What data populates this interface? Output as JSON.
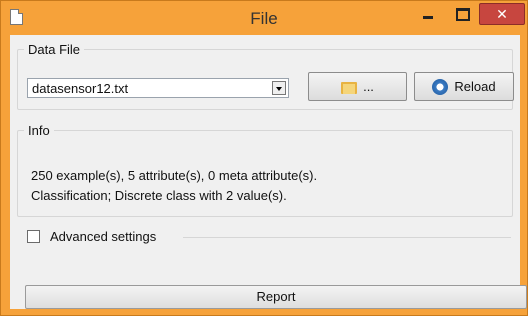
{
  "window": {
    "title": "File",
    "close_label": "✕"
  },
  "data_file": {
    "legend": "Data File",
    "selected_file": "datasensor12.txt",
    "browse_label": "...",
    "reload_label": "Reload"
  },
  "info": {
    "legend": "Info",
    "line1": "250 example(s), 5 attribute(s), 0 meta attribute(s).",
    "line2": "Classification; Discrete class with 2 value(s)."
  },
  "advanced": {
    "label": "Advanced settings",
    "checked": false
  },
  "report": {
    "label": "Report"
  },
  "icons": {
    "window": "document-icon",
    "browse": "folder-icon",
    "reload": "refresh-icon",
    "minimize": "minimize-icon",
    "maximize": "maximize-icon",
    "close": "close-icon"
  },
  "colors": {
    "titlebar": "#f6a23a",
    "close_button": "#c7463f",
    "client_background": "#f0f0f0"
  }
}
